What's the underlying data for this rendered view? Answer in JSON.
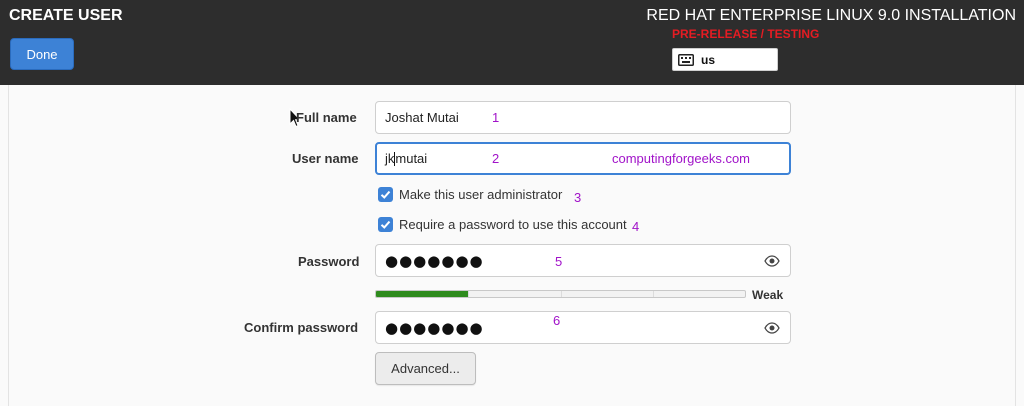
{
  "header": {
    "title": "CREATE USER",
    "done_label": "Done",
    "product_title": "RED HAT ENTERPRISE LINUX 9.0 INSTALLATION",
    "prerelease": "PRE-RELEASE / TESTING",
    "keyboard_layout": "us",
    "keyboard_icon": "keyboard-icon",
    "prerelease_color": "#e51c23",
    "accent_color": "#3d82d6"
  },
  "form": {
    "full_name": {
      "label": "Full name",
      "value": "Joshat Mutai"
    },
    "user_name": {
      "label": "User name",
      "value_before_caret": "jk",
      "value_after_caret": "mutai"
    },
    "admin_checkbox": {
      "label": "Make this user administrator",
      "checked": true
    },
    "require_password_checkbox": {
      "label": "Require a password to use this account",
      "checked": true
    },
    "password": {
      "label": "Password",
      "masked": "●●●●●●●",
      "reveal_icon": "eye-icon"
    },
    "strength": {
      "label": "Weak",
      "level": 0.25,
      "color": "#2e8b1d"
    },
    "confirm_password": {
      "label": "Confirm password",
      "masked": "●●●●●●●",
      "reveal_icon": "eye-icon"
    },
    "advanced_label": "Advanced..."
  },
  "annotations": {
    "n1": "1",
    "n2": "2",
    "n3": "3",
    "n4": "4",
    "n5": "5",
    "n6": "6",
    "watermark": "computingforgeeks.com",
    "color": "#a113c9"
  }
}
